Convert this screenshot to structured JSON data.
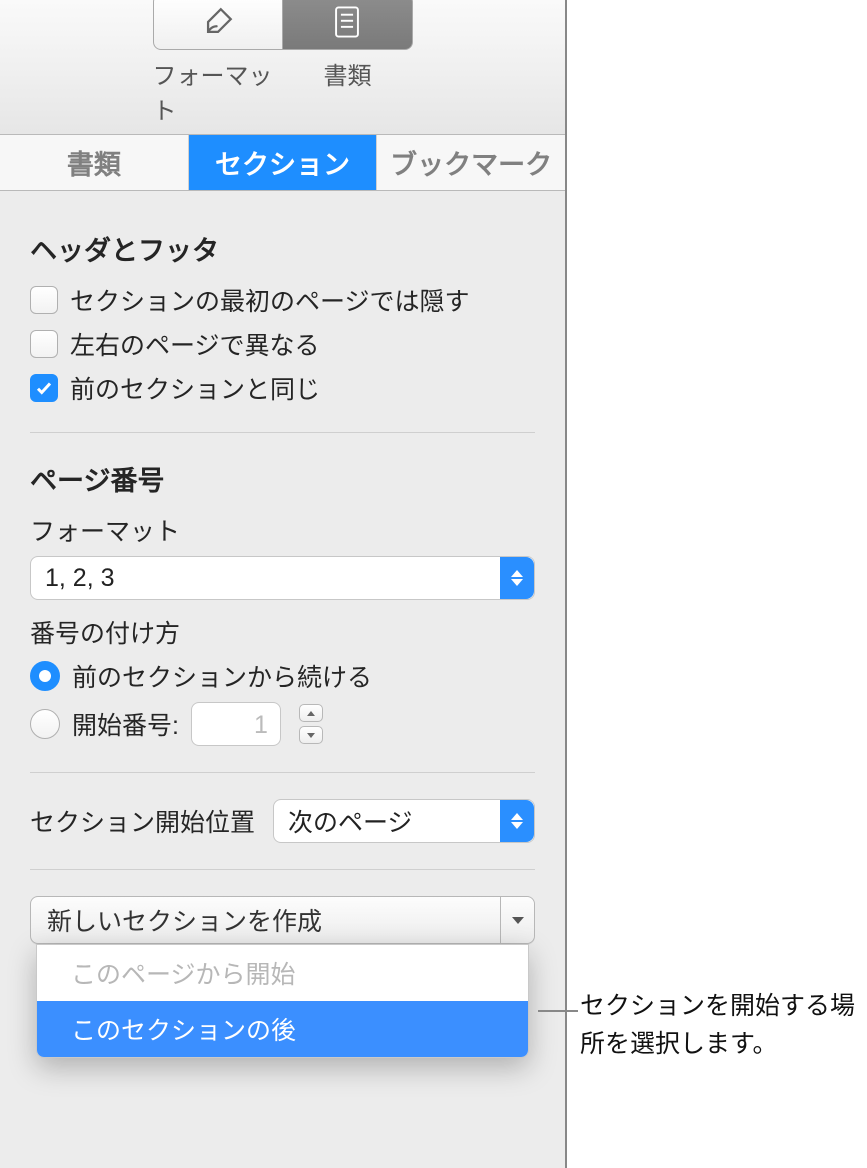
{
  "toolbar": {
    "format_label": "フォーマット",
    "document_label": "書類"
  },
  "tabs": {
    "document": "書類",
    "section": "セクション",
    "bookmark": "ブックマーク"
  },
  "headers_footers": {
    "title": "ヘッダとフッタ",
    "hide_first": "セクションの最初のページでは隠す",
    "diff_lr": "左右のページで異なる",
    "same_prev": "前のセクションと同じ"
  },
  "page_number": {
    "title": "ページ番号",
    "format_label": "フォーマット",
    "format_value": "1, 2, 3",
    "numbering_label": "番号の付け方",
    "continue": "前のセクションから続ける",
    "start_at_label": "開始番号:",
    "start_at_value": "1"
  },
  "section_start": {
    "label": "セクション開始位置",
    "value": "次のページ"
  },
  "new_section": {
    "button": "新しいセクションを作成",
    "menu": {
      "from_page": "このページから開始",
      "after_section": "このセクションの後"
    }
  },
  "callout": "セクションを開始する場所を選択します。"
}
